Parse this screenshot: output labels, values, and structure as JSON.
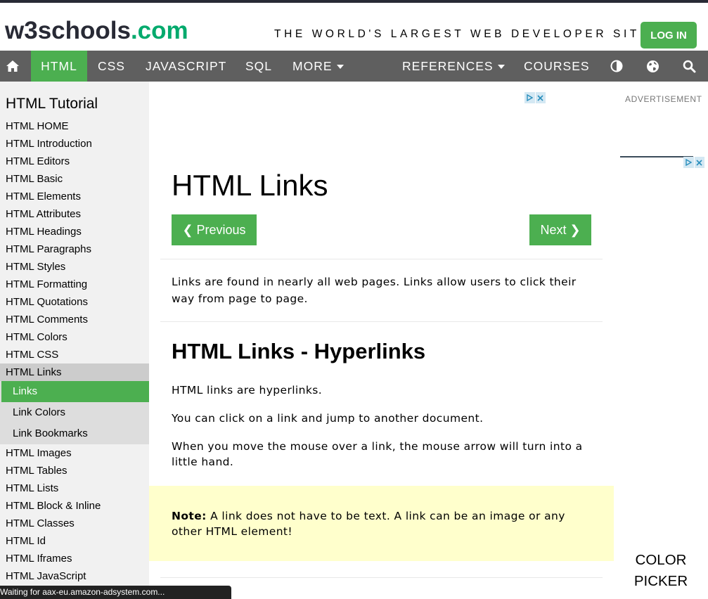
{
  "header": {
    "logo_w3": "w3schools",
    "logo_com": ".com",
    "tagline": "THE WORLD'S LARGEST WEB DEVELOPER SITE",
    "login_label": "LOG IN"
  },
  "navbar": {
    "home_icon": "home-icon",
    "html": "HTML",
    "css": "CSS",
    "javascript": "JAVASCRIPT",
    "sql": "SQL",
    "more": "MORE",
    "references": "REFERENCES",
    "courses": "COURSES",
    "theme_icon": "contrast-icon",
    "globe_icon": "globe-icon",
    "search_icon": "search-icon"
  },
  "sidebar": {
    "title": "HTML Tutorial",
    "items": [
      "HTML HOME",
      "HTML Introduction",
      "HTML Editors",
      "HTML Basic",
      "HTML Elements",
      "HTML Attributes",
      "HTML Headings",
      "HTML Paragraphs",
      "HTML Styles",
      "HTML Formatting",
      "HTML Quotations",
      "HTML Comments",
      "HTML Colors",
      "HTML CSS",
      "HTML Links"
    ],
    "sub_items": [
      "Links",
      "Link Colors",
      "Link Bookmarks"
    ],
    "items_after": [
      "HTML Images",
      "HTML Tables",
      "HTML Lists",
      "HTML Block & Inline",
      "HTML Classes",
      "HTML Id",
      "HTML Iframes",
      "HTML JavaScript"
    ]
  },
  "main": {
    "title": "HTML Links",
    "prev_label": "❮ Previous",
    "next_label": "Next ❯",
    "intro": "Links are found in nearly all web pages. Links allow users to click their way from page to page.",
    "h2": "HTML Links - Hyperlinks",
    "p1": "HTML links are hyperlinks.",
    "p2": "You can click on a link and jump to another document.",
    "p3": "When you move the mouse over a link, the mouse arrow will turn into a little hand.",
    "note_bold": "Note:",
    "note_text": " A link does not have to be text. A link can be an image or any other HTML element!"
  },
  "right": {
    "ad_label": "ADVERTISEMENT",
    "color_picker_1": "COLOR",
    "color_picker_2": "PICKER"
  },
  "status_bar": "Waiting for aax-eu.amazon-adsystem.com...",
  "colors": {
    "brand_green": "#04AA6D",
    "button_green": "#4CAF50",
    "navbar": "#5f5f5f",
    "note_bg": "#ffffcc"
  }
}
